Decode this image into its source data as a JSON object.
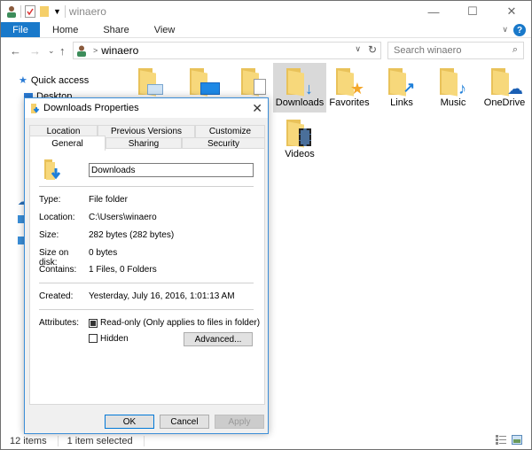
{
  "window": {
    "title": "winaero",
    "controls": [
      "minimize",
      "maximize",
      "close"
    ]
  },
  "ribbon": {
    "tabs": [
      {
        "label": "File",
        "active": true
      },
      {
        "label": "Home"
      },
      {
        "label": "Share"
      },
      {
        "label": "View"
      }
    ],
    "help_label": "?"
  },
  "address_bar": {
    "path_icon": "user-icon",
    "path": "winaero",
    "separator": ">"
  },
  "search": {
    "placeholder": "Search winaero"
  },
  "nav_pane": {
    "items": [
      {
        "label": "Quick access",
        "icon": "star-icon"
      },
      {
        "label": "Desktop",
        "icon": "desktop-icon"
      }
    ]
  },
  "content": {
    "items": [
      {
        "label": "",
        "icon": "contacts-folder-icon"
      },
      {
        "label": "",
        "icon": "desktop-folder-icon"
      },
      {
        "label": "",
        "icon": "documents-folder-icon"
      },
      {
        "label": "Downloads",
        "icon": "downloads-folder-icon",
        "selected": true
      },
      {
        "label": "Favorites",
        "icon": "favorites-folder-icon"
      },
      {
        "label": "Links",
        "icon": "links-folder-icon"
      },
      {
        "label": "Music",
        "icon": "music-folder-icon"
      },
      {
        "label": "OneDrive",
        "icon": "onedrive-folder-icon"
      },
      {
        "label": "Videos",
        "icon": "videos-folder-icon"
      }
    ]
  },
  "status_bar": {
    "items_count": "12 items",
    "selection": "1 item selected"
  },
  "dialog": {
    "title": "Downloads Properties",
    "tabs_top": [
      "Location",
      "Previous Versions",
      "Customize"
    ],
    "tabs_bottom": [
      "General",
      "Sharing",
      "Security"
    ],
    "active_tab": "General",
    "name_value": "Downloads",
    "properties": [
      {
        "key": "Type:",
        "value": "File folder"
      },
      {
        "key": "Location:",
        "value": "C:\\Users\\winaero"
      },
      {
        "key": "Size:",
        "value": "282 bytes (282 bytes)"
      },
      {
        "key": "Size on disk:",
        "value": "0 bytes"
      },
      {
        "key": "Contains:",
        "value": "1 Files, 0 Folders"
      }
    ],
    "created": {
      "key": "Created:",
      "value": "Yesterday, July 16, 2016, 1:01:13 AM"
    },
    "attributes": {
      "label": "Attributes:",
      "readonly": {
        "label": "Read-only (Only applies to files in folder)",
        "state": "indeterminate"
      },
      "hidden": {
        "label": "Hidden",
        "checked": false
      },
      "advanced_label": "Advanced..."
    },
    "buttons": {
      "ok": "OK",
      "cancel": "Cancel",
      "apply": "Apply"
    }
  }
}
